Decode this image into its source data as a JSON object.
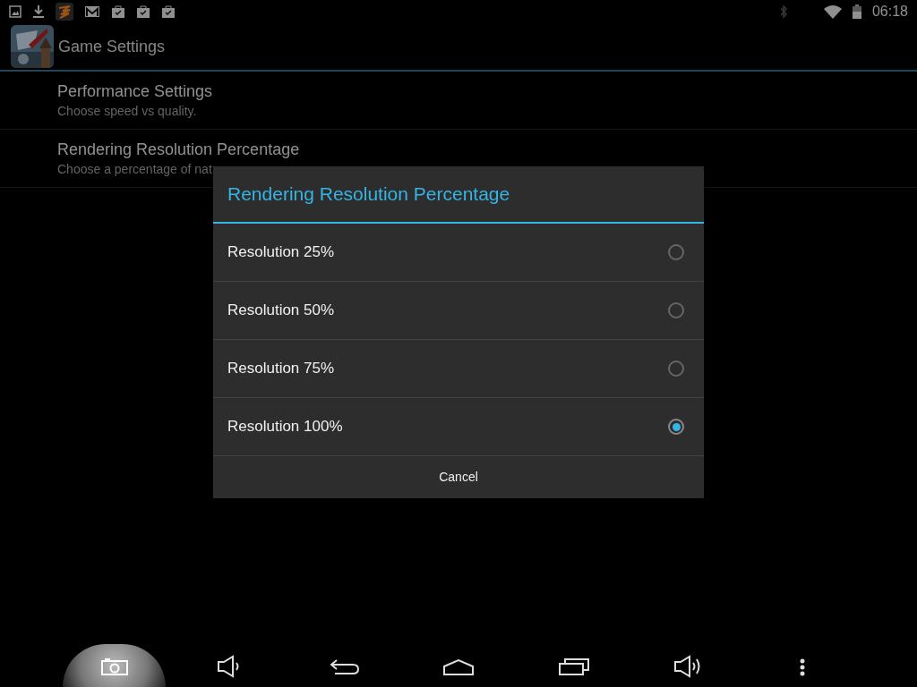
{
  "status_bar": {
    "time": "06:18"
  },
  "action_bar": {
    "title": "Game Settings"
  },
  "preferences": [
    {
      "title": "Performance Settings",
      "summary": "Choose speed vs quality."
    },
    {
      "title": "Rendering Resolution Percentage",
      "summary": "Choose a percentage of nat"
    }
  ],
  "dialog": {
    "title": "Rendering Resolution Percentage",
    "options": [
      {
        "label": "Resolution 25%",
        "selected": false
      },
      {
        "label": "Resolution 50%",
        "selected": false
      },
      {
        "label": "Resolution 75%",
        "selected": false
      },
      {
        "label": "Resolution 100%",
        "selected": true
      }
    ],
    "cancel": "Cancel"
  }
}
